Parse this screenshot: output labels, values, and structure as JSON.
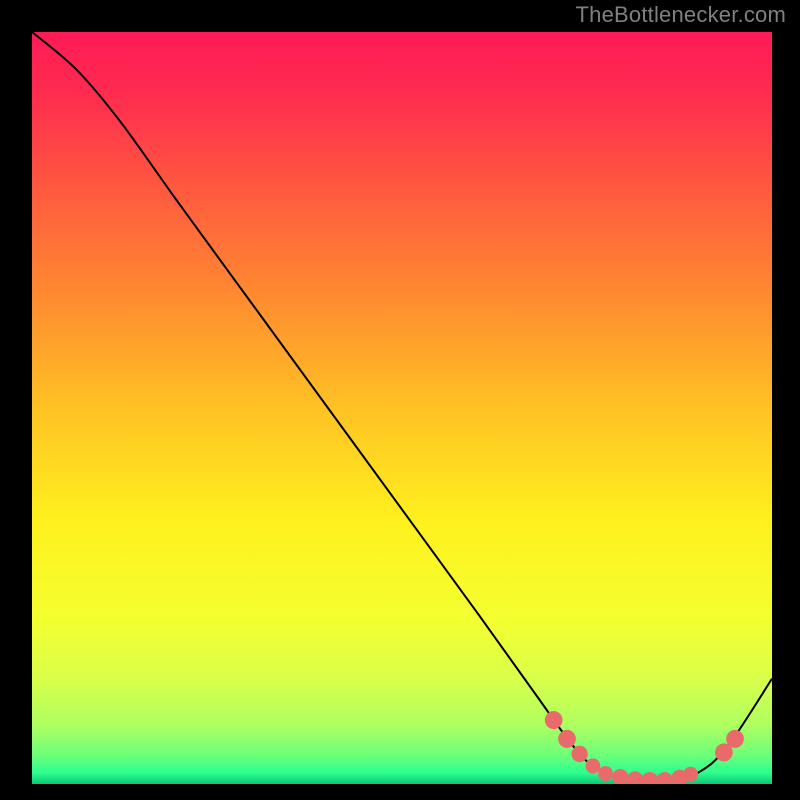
{
  "attribution": "TheBottlenecker.com",
  "chart_data": {
    "type": "line",
    "title": "",
    "xlabel": "",
    "ylabel": "",
    "xlim": [
      0,
      100
    ],
    "ylim": [
      0,
      100
    ],
    "grid": false,
    "curve": [
      {
        "x": 0,
        "y": 100
      },
      {
        "x": 6,
        "y": 95
      },
      {
        "x": 12,
        "y": 88
      },
      {
        "x": 20,
        "y": 77
      },
      {
        "x": 30,
        "y": 63.5
      },
      {
        "x": 40,
        "y": 50
      },
      {
        "x": 50,
        "y": 36.5
      },
      {
        "x": 60,
        "y": 23
      },
      {
        "x": 68,
        "y": 12
      },
      {
        "x": 72,
        "y": 6.5
      },
      {
        "x": 75,
        "y": 3
      },
      {
        "x": 78,
        "y": 1.2
      },
      {
        "x": 82,
        "y": 0.5
      },
      {
        "x": 86,
        "y": 0.5
      },
      {
        "x": 90,
        "y": 1.5
      },
      {
        "x": 94,
        "y": 5
      },
      {
        "x": 100,
        "y": 14
      }
    ],
    "markers": [
      {
        "x": 70.5,
        "y": 8.5,
        "r": 1.2
      },
      {
        "x": 72.3,
        "y": 6.0,
        "r": 1.2
      },
      {
        "x": 74.0,
        "y": 4.0,
        "r": 1.1
      },
      {
        "x": 75.8,
        "y": 2.4,
        "r": 1.0
      },
      {
        "x": 77.5,
        "y": 1.4,
        "r": 1.0
      },
      {
        "x": 79.5,
        "y": 0.9,
        "r": 1.1
      },
      {
        "x": 81.5,
        "y": 0.6,
        "r": 1.1
      },
      {
        "x": 83.5,
        "y": 0.5,
        "r": 1.1
      },
      {
        "x": 85.5,
        "y": 0.5,
        "r": 1.1
      },
      {
        "x": 87.5,
        "y": 0.8,
        "r": 1.1
      },
      {
        "x": 89.0,
        "y": 1.3,
        "r": 1.0
      },
      {
        "x": 93.5,
        "y": 4.2,
        "r": 1.2
      },
      {
        "x": 95.0,
        "y": 6.0,
        "r": 1.2
      }
    ],
    "gradient_stops": [
      {
        "offset": 0.0,
        "color": "#ff1a57"
      },
      {
        "offset": 0.08,
        "color": "#ff2b4f"
      },
      {
        "offset": 0.2,
        "color": "#ff5640"
      },
      {
        "offset": 0.35,
        "color": "#ff8a30"
      },
      {
        "offset": 0.5,
        "color": "#ffc224"
      },
      {
        "offset": 0.65,
        "color": "#fff01e"
      },
      {
        "offset": 0.78,
        "color": "#f4ff30"
      },
      {
        "offset": 0.86,
        "color": "#d9ff4a"
      },
      {
        "offset": 0.92,
        "color": "#b0ff5f"
      },
      {
        "offset": 0.96,
        "color": "#70ff78"
      },
      {
        "offset": 0.985,
        "color": "#2dff8e"
      },
      {
        "offset": 1.0,
        "color": "#0cc877"
      }
    ],
    "curve_stroke": "#000000",
    "marker_color": "#e96a6a"
  }
}
